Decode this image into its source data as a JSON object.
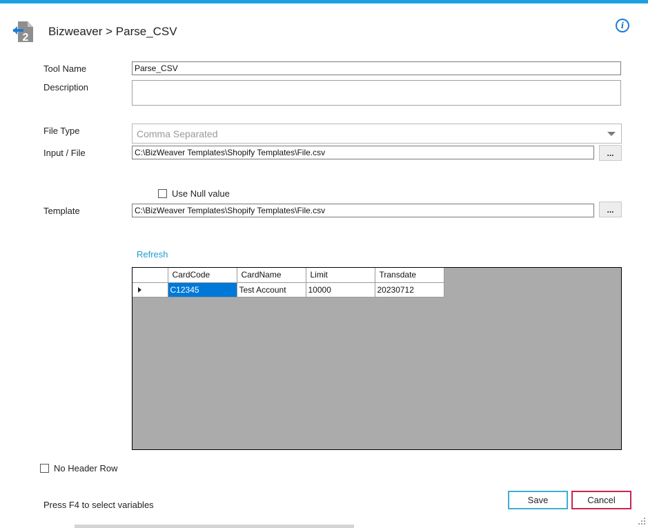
{
  "header": {
    "title": "Bizweaver > Parse_CSV",
    "app_icon": "export-step-icon",
    "info_icon": "info-icon",
    "info_glyph": "i",
    "accent_color": "#1ba1e2"
  },
  "form": {
    "tool_name_label": "Tool Name",
    "tool_name_value": "Parse_CSV",
    "description_label": "Description",
    "description_value": "",
    "file_type_label": "File Type",
    "file_type_value": "Comma Separated",
    "input_file_label": "Input / File",
    "input_file_value": "C:\\BizWeaver Templates\\Shopify Templates\\File.csv",
    "browse_label": "...",
    "use_null_label": "Use Null value",
    "template_label": "Template",
    "template_value": "C:\\BizWeaver Templates\\Shopify Templates\\File.csv",
    "refresh_label": "Refresh",
    "no_header_label": "No Header Row"
  },
  "grid": {
    "columns": [
      "CardCode",
      "CardName",
      "Limit",
      "Transdate"
    ],
    "rows": [
      [
        "C12345",
        "Test Account",
        "10000",
        "20230712"
      ]
    ],
    "selection_color": "#0078d7"
  },
  "footer": {
    "hint": "Press F4 to select variables",
    "save_label": "Save",
    "cancel_label": "Cancel"
  }
}
